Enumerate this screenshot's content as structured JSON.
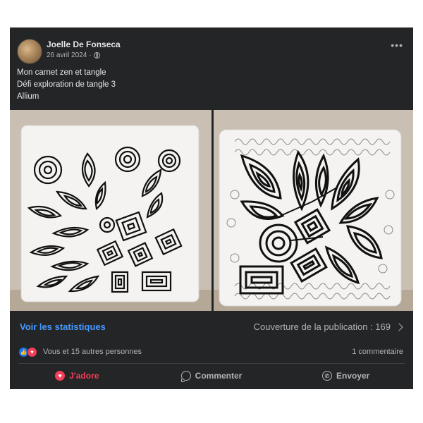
{
  "post": {
    "author": "Joelle De Fonseca",
    "date": "26 avril 2024",
    "separator": "·",
    "more_icon": "more-horizontal-icon",
    "text_lines": [
      "Mon carnet zen et tangle",
      "Défi exploration de tangle 3",
      "Allium"
    ]
  },
  "photos": [
    {
      "icon": "tangle-drawing-scattered",
      "description_hidden": true
    },
    {
      "icon": "tangle-drawing-allium",
      "description_hidden": true
    }
  ],
  "stats": {
    "link_label": "Voir les statistiques",
    "reach_label": "Couverture de la publication : 169"
  },
  "reactions": {
    "text": "Vous et 15 autres personnes",
    "comments": "1 commentaire"
  },
  "actions": {
    "love": "J'adore",
    "comment": "Commenter",
    "send": "Envoyer"
  },
  "colors": {
    "card_bg": "#242526",
    "link": "#4599ff",
    "love": "#f33e58",
    "like": "#1877f2"
  }
}
